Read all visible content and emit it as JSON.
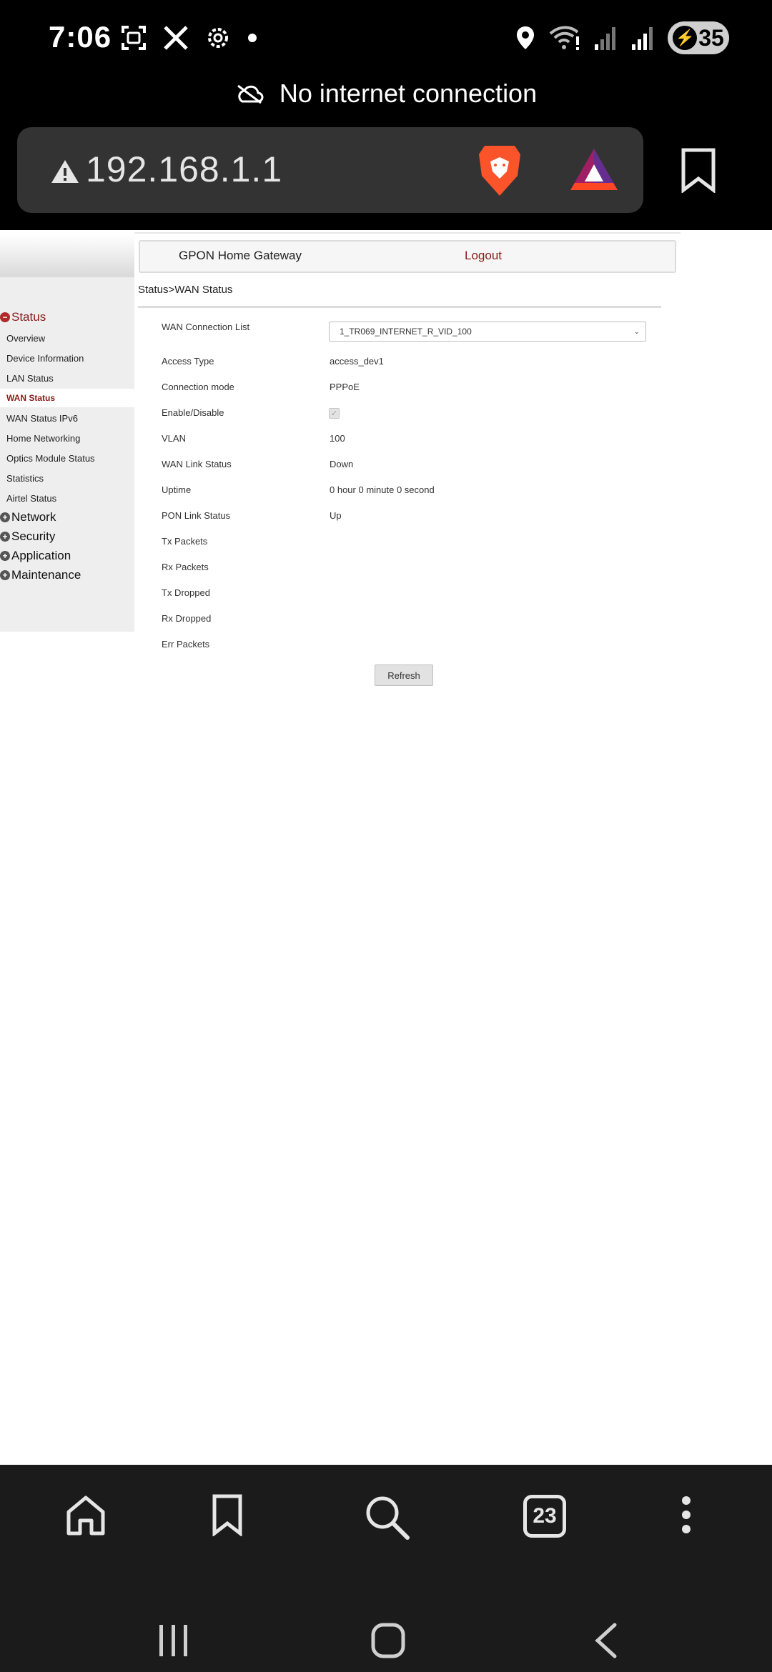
{
  "status_bar": {
    "time": "7:06",
    "battery": "35"
  },
  "connection_banner": "No internet connection",
  "url_bar": {
    "url": "192.168.1.1"
  },
  "gateway": {
    "title": "GPON Home Gateway",
    "logout": "Logout",
    "breadcrumb": "Status>WAN Status"
  },
  "sidebar": {
    "status": "Status",
    "items": [
      "Overview",
      "Device Information",
      "LAN Status",
      "WAN Status",
      "WAN Status IPv6",
      "Home Networking",
      "Optics Module Status",
      "Statistics",
      "Airtel Status"
    ],
    "network": "Network",
    "security": "Security",
    "application": "Application",
    "maintenance": "Maintenance"
  },
  "wan": {
    "connection_list_label": "WAN Connection List",
    "connection_list_value": "1_TR069_INTERNET_R_VID_100",
    "access_type_label": "Access Type",
    "access_type_value": "access_dev1",
    "connection_mode_label": "Connection mode",
    "connection_mode_value": "PPPoE",
    "enable_label": "Enable/Disable",
    "vlan_label": "VLAN",
    "vlan_value": "100",
    "link_status_label": "WAN Link Status",
    "link_status_value": "Down",
    "uptime_label": "Uptime",
    "uptime_value": "0 hour 0 minute 0 second",
    "pon_label": "PON Link Status",
    "pon_value": "Up",
    "tx_packets_label": "Tx Packets",
    "rx_packets_label": "Rx Packets",
    "tx_dropped_label": "Tx Dropped",
    "rx_dropped_label": "Rx Dropped",
    "err_packets_label": "Err Packets",
    "refresh": "Refresh"
  },
  "bottom_bar": {
    "tab_count": "23"
  }
}
